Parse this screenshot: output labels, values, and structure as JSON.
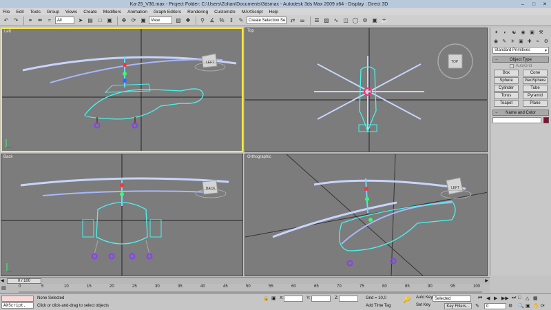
{
  "window": {
    "title": "Ka-25_V36.max      - Project Folder: C:\\Users\\Zoltan\\Documents\\3dsmax      - Autodesk 3ds Max  2009 x64       - Display : Direct 3D"
  },
  "menu": [
    "File",
    "Edit",
    "Tools",
    "Group",
    "Views",
    "Create",
    "Modifiers",
    "Animation",
    "Graph Editors",
    "Rendering",
    "Customize",
    "MAXScript",
    "Help"
  ],
  "toolbar": {
    "filter_value": "All",
    "refcoord_value": "View",
    "selection_set_placeholder": "Create Selection Se"
  },
  "viewports": {
    "left": {
      "label": "Left",
      "cube": "LEFT"
    },
    "top": {
      "label": "Top",
      "cube": "TOP"
    },
    "back": {
      "label": "Back",
      "cube": "BACK"
    },
    "ortho": {
      "label": "Orthographic",
      "cube": "LEFT"
    }
  },
  "command_panel": {
    "category_dropdown": "Standard Primitives",
    "object_type_title": "Object Type",
    "autogrid_label": "AutoGrid",
    "buttons": [
      "Box",
      "Cone",
      "Sphere",
      "GeoSphere",
      "Cylinder",
      "Tube",
      "Torus",
      "Pyramid",
      "Teapot",
      "Plane"
    ],
    "name_color_title": "Name and Color",
    "object_color": "#8b0d2e"
  },
  "timeslider": {
    "current": "0 / 100",
    "ticks": [
      "0",
      "5",
      "10",
      "15",
      "20",
      "25",
      "30",
      "35",
      "40",
      "45",
      "50",
      "55",
      "60",
      "65",
      "70",
      "75",
      "80",
      "85",
      "90",
      "95",
      "100"
    ]
  },
  "status": {
    "maxscript_label": "AXScript.",
    "selection": "None Selected",
    "prompt": "Click or click-and-drag to select objects",
    "x_label": "X:",
    "y_label": "Y:",
    "z_label": "Z:",
    "grid": "Grid = 10,0",
    "add_time_tag": "Add Time Tag",
    "auto_key": "Auto Key",
    "set_key": "Set Key",
    "selected_combo": "Selected",
    "key_filters": "Key Filters...",
    "frame_value": "0"
  }
}
